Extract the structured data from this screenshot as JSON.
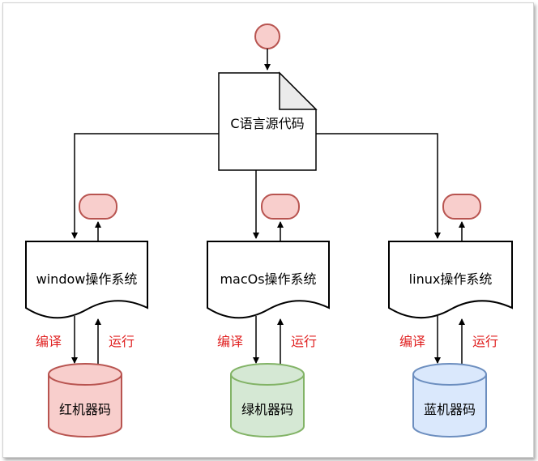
{
  "source": {
    "label": "C语言源代码"
  },
  "systems": [
    {
      "label": "window操作系统",
      "compile_label": "编译",
      "run_label": "运行",
      "machine_label": "红机器码"
    },
    {
      "label": "macOs操作系统",
      "compile_label": "编译",
      "run_label": "运行",
      "machine_label": "绿机器码"
    },
    {
      "label": "linux操作系统",
      "compile_label": "编译",
      "run_label": "运行",
      "machine_label": "蓝机器码"
    }
  ],
  "colors": {
    "terminator_fill": "#f8cecc",
    "terminator_stroke": "#b85450",
    "red_fill": "#f8cecc",
    "red_stroke": "#b85450",
    "green_fill": "#d5e8d4",
    "green_stroke": "#82b366",
    "blue_fill": "#dae8fc",
    "blue_stroke": "#6c8ebf",
    "edge_label": "#e02020"
  }
}
